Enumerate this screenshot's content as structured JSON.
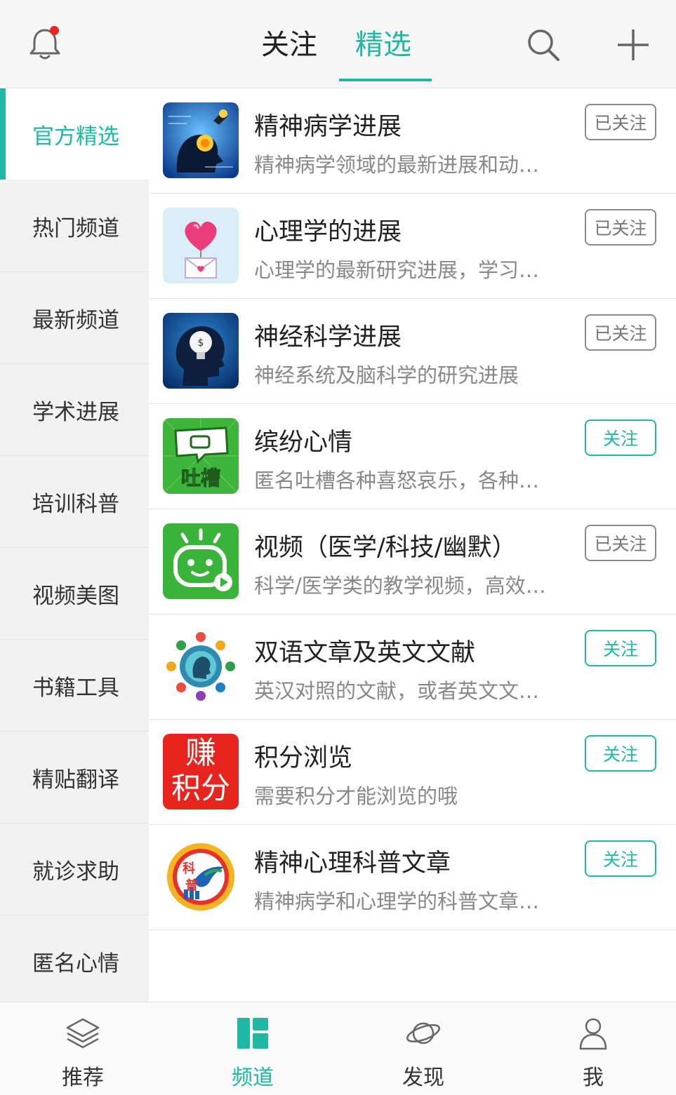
{
  "header": {
    "tabs": [
      {
        "label": "关注",
        "active": false
      },
      {
        "label": "精选",
        "active": true
      }
    ],
    "icons": [
      "bell-icon",
      "search-icon",
      "plus-icon"
    ],
    "notification_dot": true,
    "accent_color": "#1fb9a3"
  },
  "sidebar": {
    "items": [
      {
        "label": "官方精选",
        "active": true
      },
      {
        "label": "热门频道"
      },
      {
        "label": "最新频道"
      },
      {
        "label": "学术进展"
      },
      {
        "label": "培训科普"
      },
      {
        "label": "视频美图"
      },
      {
        "label": "书籍工具"
      },
      {
        "label": "精贴翻译"
      },
      {
        "label": "就诊求助"
      },
      {
        "label": "匿名心情"
      }
    ]
  },
  "channels": [
    {
      "title": "精神病学进展",
      "desc": "精神病学领域的最新进展和动…",
      "button": "已关注",
      "state": "followed",
      "thumb": "brain-gear-thumb"
    },
    {
      "title": "心理学的进展",
      "desc": "心理学的最新研究进展，学习…",
      "button": "已关注",
      "state": "followed",
      "thumb": "heart-envelope-thumb"
    },
    {
      "title": "神经科学进展",
      "desc": "神经系统及脑科学的研究进展",
      "button": "已关注",
      "state": "followed",
      "thumb": "head-bulb-thumb"
    },
    {
      "title": "缤纷心情",
      "desc": "匿名吐槽各种喜怒哀乐，各种…",
      "button": "关注",
      "state": "not-followed",
      "thumb": "tucao-thumb",
      "thumb_text": "吐槽"
    },
    {
      "title": "视频（医学/科技/幽默）",
      "desc": "科学/医学类的教学视频，高效…",
      "button": "已关注",
      "state": "followed",
      "thumb": "tv-face-thumb"
    },
    {
      "title": "双语文章及英文文献",
      "desc": "英汉对照的文献，或者英文文…",
      "button": "关注",
      "state": "not-followed",
      "thumb": "globe-ring-thumb"
    },
    {
      "title": "积分浏览",
      "desc": "需要积分才能浏览的哦",
      "button": "关注",
      "state": "not-followed",
      "thumb": "earn-points-thumb",
      "thumb_text": [
        "赚",
        "积分"
      ]
    },
    {
      "title": "精神心理科普文章",
      "desc": "精神病学和心理学的科普文章…",
      "button": "关注",
      "state": "not-followed",
      "thumb": "kepu-bird-thumb",
      "thumb_text": [
        "科",
        "普"
      ]
    }
  ],
  "bottom_nav": [
    {
      "label": "推荐",
      "icon": "layers-icon",
      "active": false
    },
    {
      "label": "频道",
      "icon": "channel-grid-icon",
      "active": true
    },
    {
      "label": "发现",
      "icon": "planet-icon",
      "active": false
    },
    {
      "label": "我",
      "icon": "person-icon",
      "active": false
    }
  ]
}
